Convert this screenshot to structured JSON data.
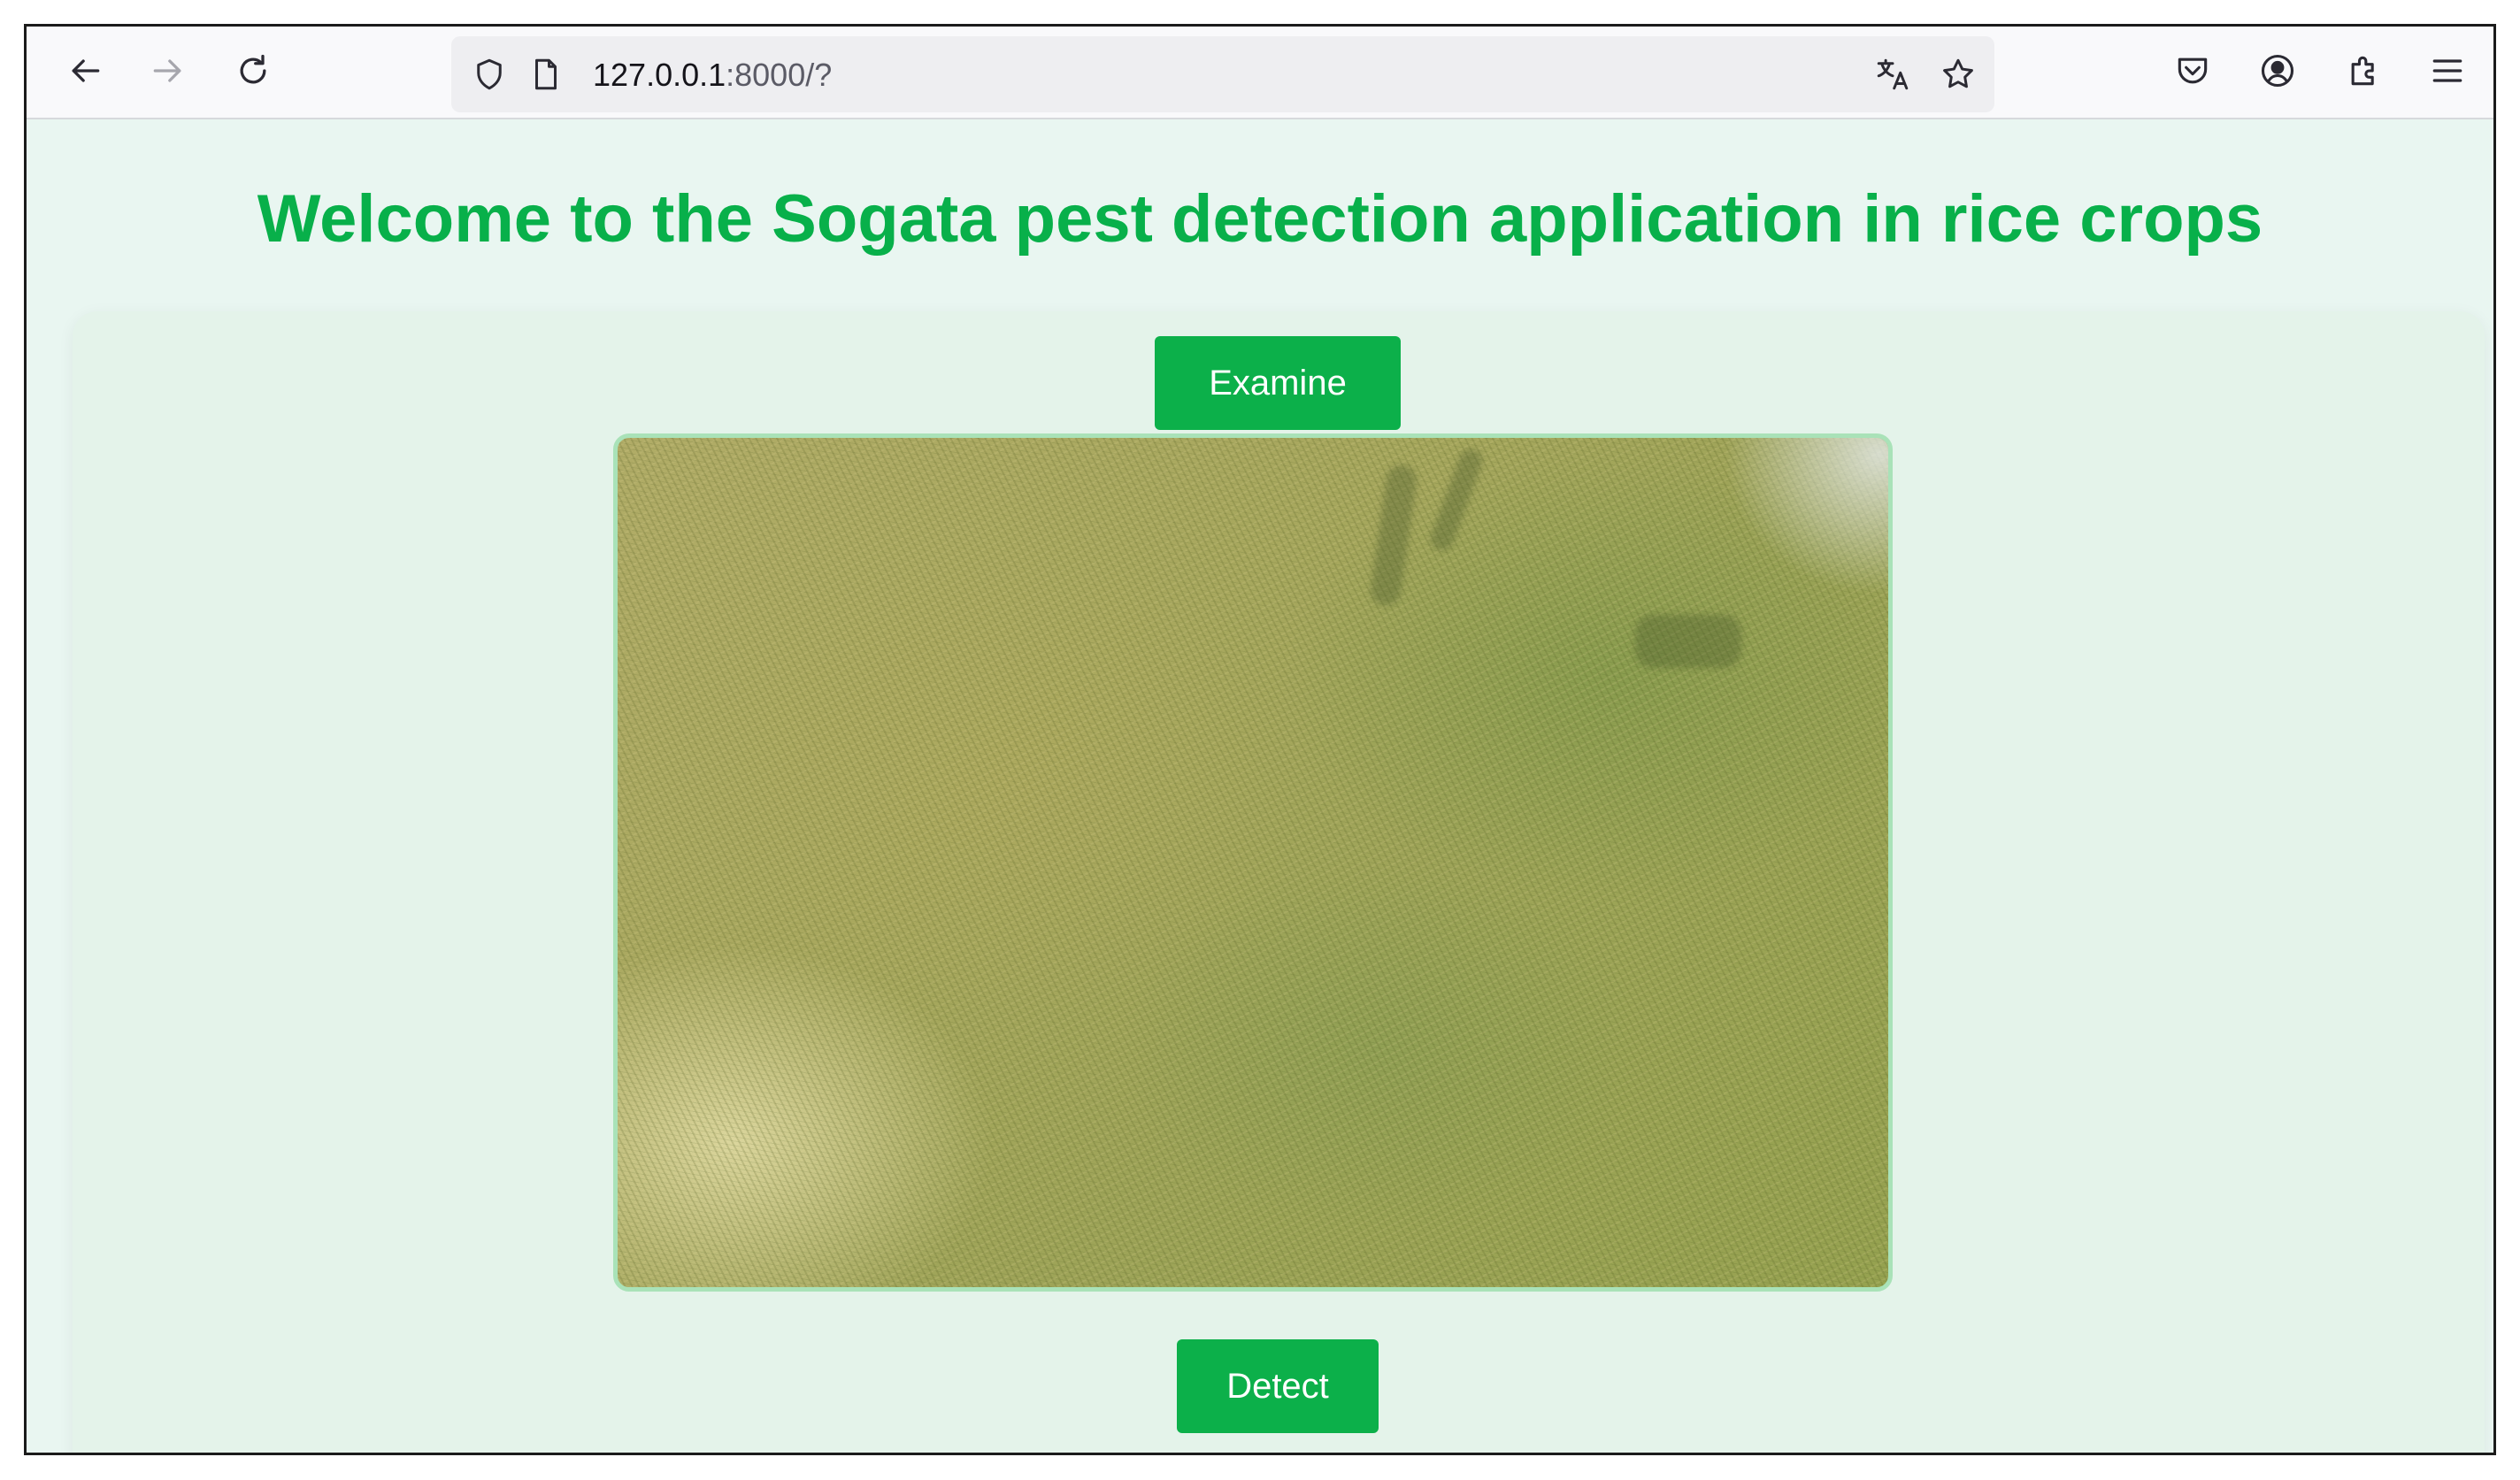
{
  "browser": {
    "url_host": "127.0.0.1",
    "url_rest": ":8000/?"
  },
  "page": {
    "title": "Welcome to the Sogata pest detection application in rice crops",
    "examine_label": "Examine",
    "detect_label": "Detect"
  },
  "icons": {
    "back": "back-arrow-icon",
    "forward": "forward-arrow-icon",
    "reload": "reload-icon",
    "shield": "shield-icon",
    "page": "page-icon",
    "translate": "translate-icon",
    "star": "star-icon",
    "pocket": "pocket-icon",
    "account": "account-icon",
    "extensions": "extensions-icon",
    "menu": "menu-icon"
  },
  "colors": {
    "accent": "#08b04a",
    "page_bg": "#e9f6f1"
  }
}
